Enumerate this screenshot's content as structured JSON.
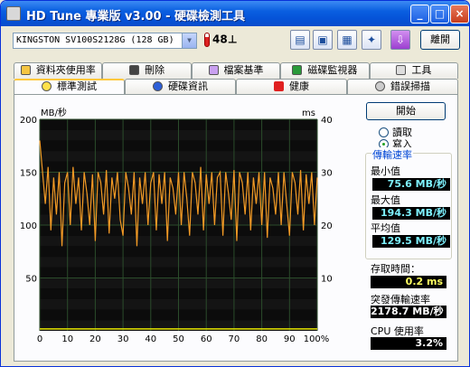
{
  "window": {
    "title": "HD Tune 專業版 v3.00 - 硬碟檢測工具",
    "minimize": "_",
    "maximize": "□",
    "close": "×"
  },
  "toolbar": {
    "drive": "KINGSTON SV100S2128G (128 GB)",
    "temperature": "48",
    "temperature_unit": "⊥",
    "exit_label": "離開",
    "icons": [
      "copy-text-icon",
      "copy-screenshot-icon",
      "save-icon",
      "options-icon",
      "download-icon"
    ]
  },
  "tabs_row1": [
    {
      "label": "資料夾使用率",
      "icon": "folder-icon"
    },
    {
      "label": "刪除",
      "icon": "trash-icon"
    },
    {
      "label": "檔案基準",
      "icon": "file-benchmark-icon"
    },
    {
      "label": "磁碟監視器",
      "icon": "monitor-icon"
    },
    {
      "label": "工具",
      "icon": "speaker-icon"
    }
  ],
  "tabs_row2": [
    {
      "label": "標準測試",
      "icon": "lightbulb-icon",
      "active": true
    },
    {
      "label": "硬碟資訊",
      "icon": "info-icon"
    },
    {
      "label": "健康",
      "icon": "health-cross-icon"
    },
    {
      "label": "錯誤掃描",
      "icon": "magnifier-icon"
    }
  ],
  "controls": {
    "start_label": "開始",
    "read_label": "讀取",
    "write_label": "寫入",
    "selected_mode": "write"
  },
  "stats": {
    "group_title": "傳輸速率",
    "min_label": "最小值",
    "min_value": "75.6 MB/秒",
    "max_label": "最大值",
    "max_value": "194.3 MB/秒",
    "avg_label": "平均值",
    "avg_value": "129.5 MB/秒",
    "access_label": "存取時間：",
    "access_value": "0.2 ms",
    "burst_label": "突發傳輸速率",
    "burst_value": "2178.7 MB/秒",
    "cpu_label": "CPU 使用率",
    "cpu_value": "3.2%"
  },
  "chart_data": {
    "type": "line",
    "ylabel_left": "MB/秒",
    "ylabel_right": "ms",
    "ylim_left": [
      0,
      200
    ],
    "ylim_right": [
      0,
      40
    ],
    "yticks_left": [
      50,
      100,
      150,
      200
    ],
    "yticks_right": [
      10,
      20,
      30,
      40
    ],
    "xticks": [
      0,
      10,
      20,
      30,
      40,
      50,
      60,
      70,
      80,
      90
    ],
    "xtick_last": "100%",
    "xlim": [
      0,
      100
    ],
    "grid": true,
    "colors": {
      "transfer": "#F29A25",
      "access": "#E6E600",
      "background": "#000000",
      "grid": "#2B4C2B"
    },
    "series": [
      {
        "role": "transfer",
        "axis": "left",
        "x": [
          0,
          1,
          2,
          3,
          4,
          5,
          6,
          7,
          8,
          9,
          10,
          11,
          12,
          13,
          14,
          15,
          16,
          17,
          18,
          19,
          20,
          21,
          22,
          23,
          24,
          25,
          26,
          27,
          28,
          29,
          30,
          31,
          32,
          33,
          34,
          35,
          36,
          37,
          38,
          39,
          40,
          41,
          42,
          43,
          44,
          45,
          46,
          47,
          48,
          49,
          50,
          51,
          52,
          53,
          54,
          55,
          56,
          57,
          58,
          59,
          60,
          61,
          62,
          63,
          64,
          65,
          66,
          67,
          68,
          69,
          70,
          71,
          72,
          73,
          74,
          75,
          76,
          77,
          78,
          79,
          80,
          81,
          82,
          83,
          84,
          85,
          86,
          87,
          88,
          89,
          90,
          91,
          92,
          93,
          94,
          95,
          96,
          97,
          98,
          99,
          100
        ],
        "values": [
          180,
          150,
          120,
          155,
          95,
          145,
          110,
          150,
          80,
          140,
          150,
          100,
          155,
          120,
          145,
          95,
          150,
          130,
          100,
          148,
          85,
          150,
          140,
          110,
          152,
          92,
          145,
          125,
          150,
          105,
          90,
          150,
          135,
          110,
          150,
          80,
          145,
          120,
          150,
          100,
          140,
          150,
          95,
          148,
          120,
          150,
          85,
          145,
          135,
          110,
          150,
          100,
          150,
          125,
          90,
          150,
          140,
          110,
          155,
          95,
          148,
          120,
          150,
          100,
          145,
          150,
          90,
          150,
          130,
          105,
          152,
          85,
          150,
          140,
          110,
          150,
          95,
          145,
          120,
          150,
          100,
          150,
          88,
          145,
          135,
          110,
          150,
          100,
          150,
          120,
          90,
          150,
          140,
          110,
          152,
          95,
          148,
          120,
          150,
          100,
          145
        ]
      },
      {
        "role": "access",
        "axis": "right",
        "x": [
          0,
          10,
          20,
          30,
          40,
          50,
          60,
          70,
          80,
          90,
          100
        ],
        "values": [
          0.2,
          0.2,
          0.2,
          0.2,
          0.2,
          0.2,
          0.2,
          0.2,
          0.2,
          0.2,
          0.2
        ]
      }
    ]
  }
}
